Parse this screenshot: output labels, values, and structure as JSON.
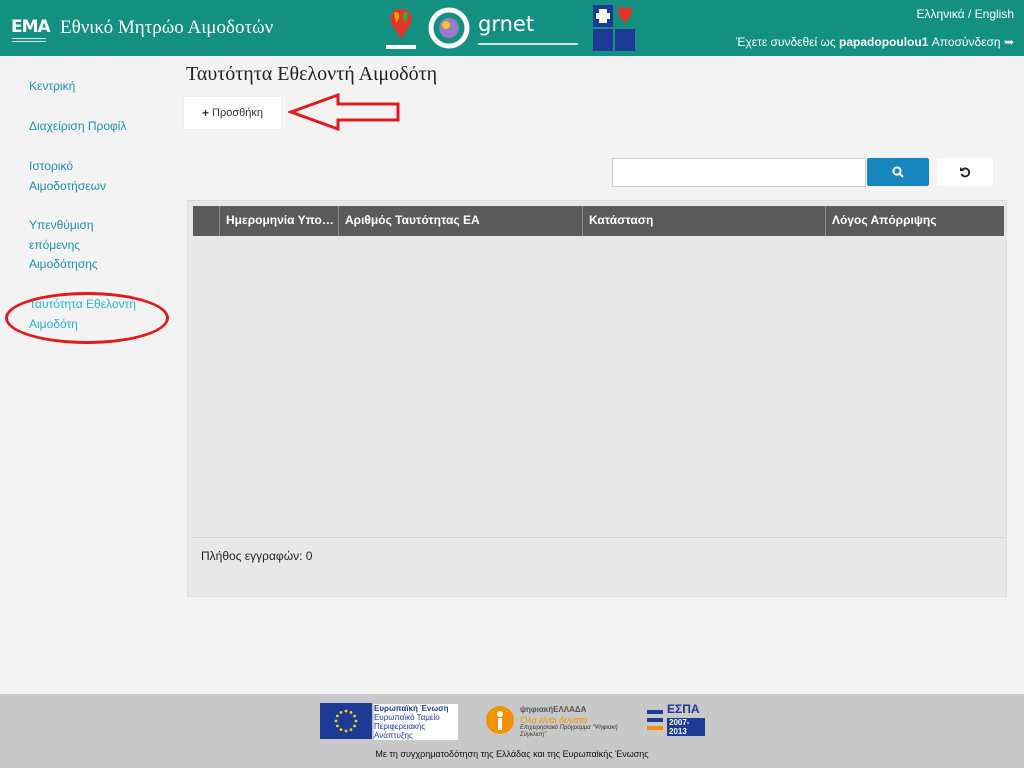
{
  "header": {
    "logo_text": "EMA",
    "app_title": "Εθνικό Μητρώο Αιμοδοτών",
    "partner_logos": [
      "ekea-logo",
      "grnet-logo",
      "health-ministry-logo"
    ],
    "grnet_text": "grnet",
    "lang_el": "Ελληνικά",
    "lang_sep": "/",
    "lang_en": "English",
    "logged_in_prefix": "Έχετε συνδεθεί ως",
    "username": "papadopoulou1",
    "logout_label": "Αποσύνδεση"
  },
  "sidebar": {
    "items": [
      {
        "label": "Κεντρική"
      },
      {
        "label": "Διαχείριση Προφίλ"
      },
      {
        "label": "Ιστορικό Αιμοδοτήσεων"
      },
      {
        "label": "Υπενθύμιση επόμενης Αιμοδότησης"
      },
      {
        "label": "Ταυτότητα Εθελοντή Αιμοδότη"
      }
    ],
    "active_index": 4
  },
  "main": {
    "page_title": "Ταυτότητα Εθελοντή Αιμοδότη",
    "add_button": "Προσθήκη",
    "search_placeholder": "",
    "grid": {
      "columns": [
        "",
        "Ημερομηνία Υποβ…",
        "Αριθμός Ταυτότητας ΕΑ",
        "Κατάσταση",
        "Λόγος Απόρριψης"
      ],
      "rows": [],
      "record_count_label": "Πλήθος εγγραφών: 0"
    }
  },
  "footer": {
    "eu_title": "Ευρωπαϊκή Ένωση",
    "eu_fund": "Ευρωπαϊκό Ταμείο Περιφερειακής Ανάπτυξης",
    "digital_brand": "ψηφιακήΕΛΛΑΔΑ",
    "digital_slogan": "Όλα είναι δυνατά",
    "digital_program": "Επιχειρησιακό Πρόγραμμα \"Ψηφιακή Σύγκλιση\"",
    "espa_text": "ΕΣΠΑ",
    "espa_years": "2007-2013",
    "cofunding_note": "Με τη συγχρηματοδότηση της Ελλάδας και της Ευρωπαϊκής Ένωσης"
  },
  "colors": {
    "header_bg": "#13907f",
    "link": "#1e90ad",
    "search_btn": "#1785be",
    "grid_header": "#5b5b5b",
    "annotation_red": "#e21a1a"
  }
}
